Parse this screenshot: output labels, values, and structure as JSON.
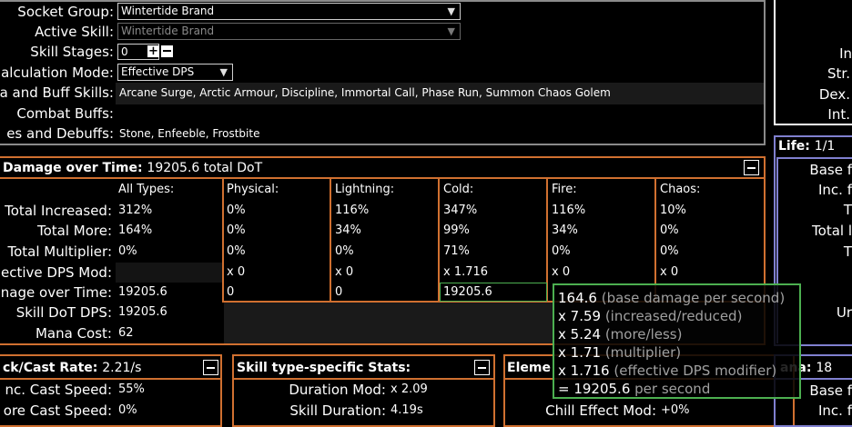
{
  "config": {
    "socket_group_label": "Socket Group:",
    "socket_group_value": "Wintertide Brand",
    "active_skill_label": "Active Skill:",
    "active_skill_value": "Wintertide Brand",
    "skill_stages_label": "Skill Stages:",
    "skill_stages_value": "0",
    "calc_mode_label": "alculation Mode:",
    "calc_mode_value": "Effective DPS",
    "aura_label": "a and Buff Skills:",
    "aura_value": "Arcane Surge, Arctic Armour, Discipline, Immortal Call, Phase Run, Summon Chaos Golem",
    "combat_label": "Combat Buffs:",
    "combat_value": "",
    "curses_label": "es and Debuffs:",
    "curses_value": "Stone, Enfeeble, Frostbite"
  },
  "right_top": {
    "l1": "In",
    "l2": "Str.",
    "l3": "Dex.",
    "l4": "Int."
  },
  "life_panel": {
    "title": "Life:",
    "value": "1/1",
    "rows": [
      "Base f",
      "Inc. f",
      "T",
      "Total l",
      "T",
      "",
      "Ur"
    ]
  },
  "dot": {
    "title": "Damage over Time:",
    "title_value": "19205.6 total DoT",
    "headers": [
      "All Types:",
      "Physical:",
      "Lightning:",
      "Cold:",
      "Fire:",
      "Chaos:"
    ],
    "row_labels": [
      "Total Increased:",
      "Total More:",
      "Total Multiplier:",
      "ective DPS Mod:",
      "nage over Time:",
      "Skill DoT DPS:",
      "Mana Cost:"
    ],
    "rows": [
      [
        "312%",
        "0%",
        "116%",
        "347%",
        "116%",
        "10%"
      ],
      [
        "164%",
        "0%",
        "34%",
        "99%",
        "34%",
        "0%"
      ],
      [
        "0%",
        "0%",
        "0%",
        "71%",
        "0%",
        "0%"
      ],
      [
        "",
        "x 0",
        "x 0",
        "x 1.716",
        "x 0",
        "x 0"
      ],
      [
        "19205.6",
        "0",
        "0",
        "19205.6",
        "",
        ""
      ],
      [
        "19205.6"
      ],
      [
        "62"
      ]
    ]
  },
  "tooltip": [
    {
      "num": "164.6",
      "desc": "(base damage per second)"
    },
    {
      "num": "x 7.59",
      "desc": "(increased/reduced)"
    },
    {
      "num": "x 5.24",
      "desc": "(more/less)"
    },
    {
      "num": "x 1.71",
      "desc": "(multiplier)"
    },
    {
      "num": "x 1.716",
      "desc": "(effective DPS modifier)"
    },
    {
      "num": "= 19205.6",
      "desc": "per second"
    }
  ],
  "attack_panel": {
    "title": "ck/Cast Rate:",
    "title_value": "2.21/s",
    "rows": [
      {
        "label": "nc. Cast Speed:",
        "value": "55%"
      },
      {
        "label": "ore Cast Speed:",
        "value": "0%"
      }
    ]
  },
  "skill_panel": {
    "title": "Skill type-specific Stats:",
    "rows": [
      {
        "label": "Duration Mod:",
        "value": "x 2.09"
      },
      {
        "label": "Skill Duration:",
        "value": "4.19s"
      }
    ]
  },
  "elem_panel": {
    "title": "Eleme",
    "rows": [
      {
        "label": "Chill Effect Mod:",
        "value": "+0%"
      }
    ]
  },
  "mana_panel": {
    "title": "ana:",
    "value": "18",
    "rows": [
      "Base f",
      "Inc. f"
    ]
  }
}
